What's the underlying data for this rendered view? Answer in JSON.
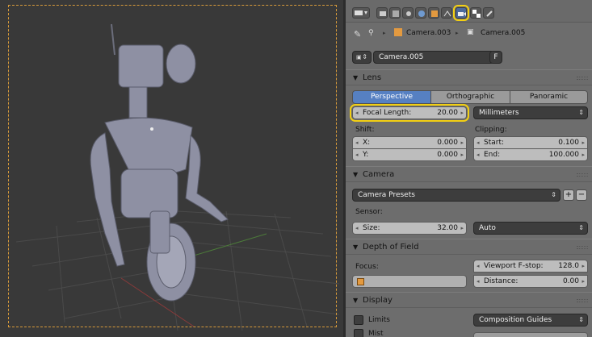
{
  "breadcrumb": {
    "camera_object": "Camera.003",
    "camera_data": "Camera.005"
  },
  "datablock": {
    "name": "Camera.005",
    "fake_user_label": "F"
  },
  "lens": {
    "title": "Lens",
    "modes": [
      "Perspective",
      "Orthographic",
      "Panoramic"
    ],
    "active_mode": "Perspective",
    "focal_length_label": "Focal Length:",
    "focal_length_value": "20.00",
    "unit": "Millimeters",
    "shift_label": "Shift:",
    "shift_x_label": "X:",
    "shift_x_value": "0.000",
    "shift_y_label": "Y:",
    "shift_y_value": "0.000",
    "clipping_label": "Clipping:",
    "clip_start_label": "Start:",
    "clip_start_value": "0.100",
    "clip_end_label": "End:",
    "clip_end_value": "100.000"
  },
  "camera": {
    "title": "Camera",
    "presets_label": "Camera Presets",
    "add_label": "+",
    "remove_label": "−",
    "sensor_label": "Sensor:",
    "size_label": "Size:",
    "size_value": "32.00",
    "sensor_fit": "Auto"
  },
  "dof": {
    "title": "Depth of Field",
    "focus_label": "Focus:",
    "fstop_label": "Viewport F-stop:",
    "fstop_value": "128.0",
    "distance_label": "Distance:",
    "distance_value": "0.00"
  },
  "display": {
    "title": "Display",
    "limits_label": "Limits",
    "mist_label": "Mist",
    "guides_label": "Composition Guides"
  },
  "colors": {
    "accent_blue": "#5680c2",
    "highlight_yellow": "#f2cf13",
    "panel_bg": "#6d6d6d",
    "viewport_bg": "#393939"
  }
}
